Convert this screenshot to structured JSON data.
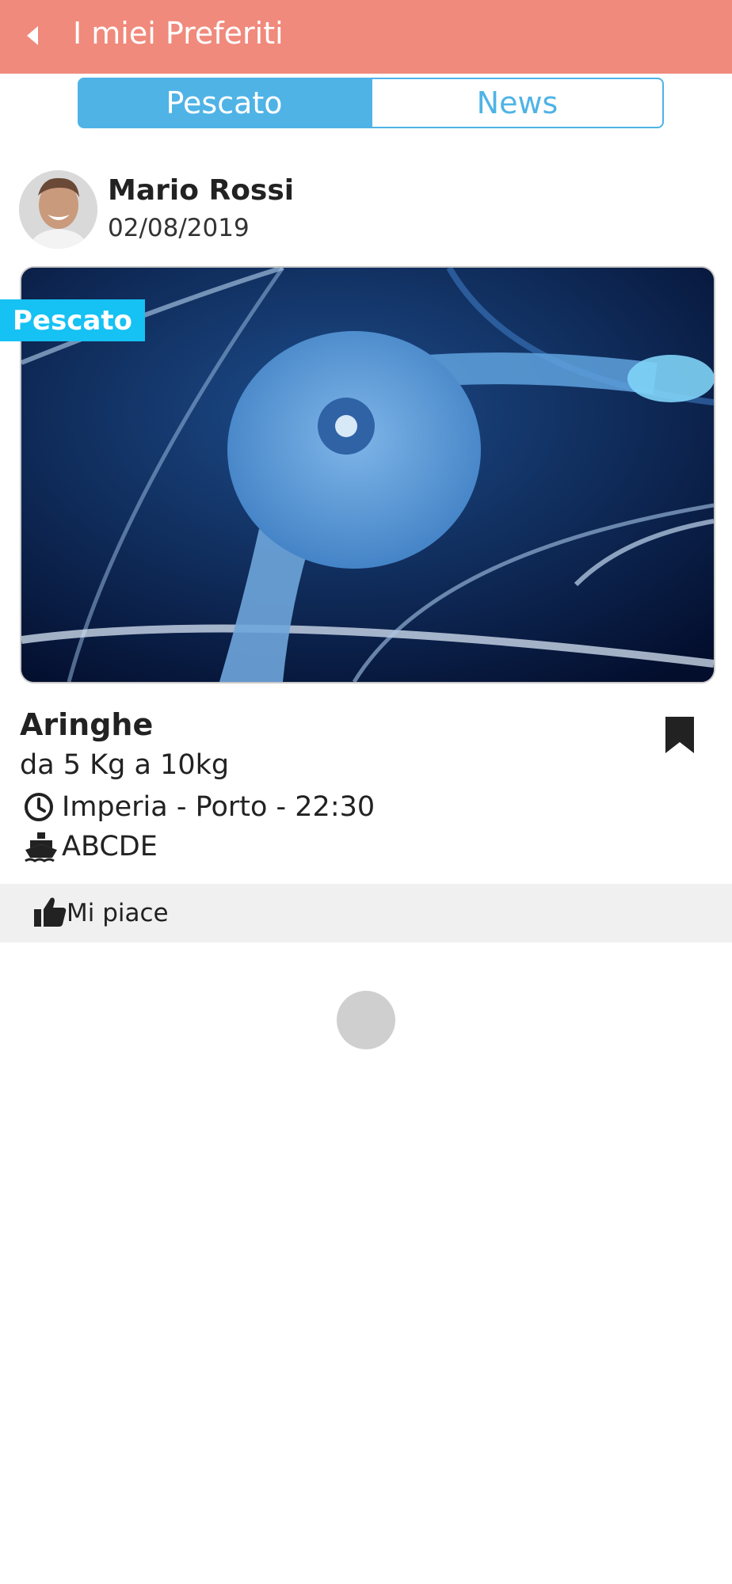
{
  "header": {
    "title": "I miei Preferiti",
    "back_icon": "caret-left-icon",
    "background": "#f08a7c"
  },
  "tabs": [
    {
      "label": "Pescato",
      "active": true
    },
    {
      "label": "News",
      "active": false
    }
  ],
  "accent_color": "#4fb3e6",
  "post": {
    "author": "Mario Rossi",
    "date": "02/08/2019",
    "badge": "Pescato",
    "badge_color": "#16c1f3",
    "fish": "Aringhe",
    "weight": "da 5 Kg a 10kg",
    "location": "Imperia - Porto - 22:30",
    "location_icon": "clock-icon",
    "boat": "ABCDE",
    "boat_icon": "ship-icon",
    "bookmark_icon": "bookmark-icon"
  },
  "actions": {
    "like_label": "Mi piace",
    "like_icon": "thumbs-up-icon"
  }
}
